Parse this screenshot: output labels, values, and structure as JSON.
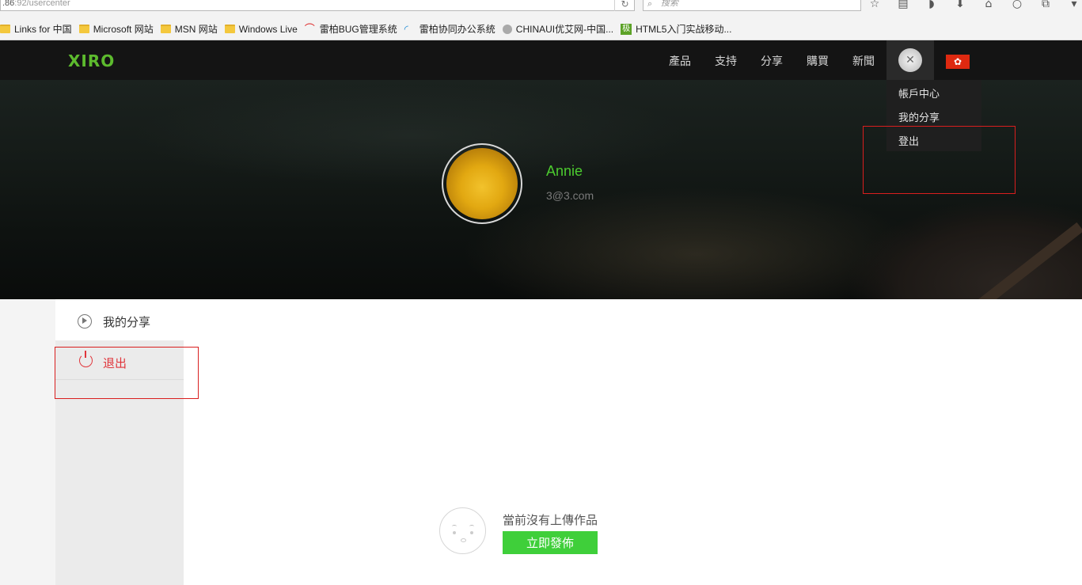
{
  "browser": {
    "url_host": ".86",
    "url_path": ":92/usercenter",
    "search_placeholder": "搜索",
    "reload_icon": "reload-icon",
    "toolbar_icons": [
      "star-icon",
      "reading-list-icon",
      "pocket-icon",
      "download-icon",
      "home-icon",
      "chat-icon",
      "extension-icon",
      "menu-icon"
    ]
  },
  "bookmarks": [
    {
      "label": "Links for 中国",
      "icon": "folder-icon"
    },
    {
      "label": "Microsoft 网站",
      "icon": "folder-icon"
    },
    {
      "label": "MSN 网站",
      "icon": "folder-icon"
    },
    {
      "label": "Windows Live",
      "icon": "folder-icon"
    },
    {
      "label": "雷柏BUG管理系统",
      "icon": "rapoo-icon"
    },
    {
      "label": "雷柏协同办公系统",
      "icon": "wifi-icon"
    },
    {
      "label": "CHINAUI优艾网-中国...",
      "icon": "globe-icon"
    },
    {
      "label": "HTML5入门实战移动...",
      "icon": "site-icon"
    }
  ],
  "nav": {
    "logo": "XIRO",
    "items": [
      "產品",
      "支持",
      "分享",
      "購買",
      "新聞"
    ],
    "flag_icon": "hong-kong-flag-icon"
  },
  "dropdown": {
    "items": [
      "帳戶中心",
      "我的分享",
      "登出"
    ]
  },
  "profile": {
    "name": "Annie",
    "email": "3@3.com"
  },
  "sidebar": {
    "items": [
      {
        "label": "我的分享",
        "icon": "play-circle-icon"
      },
      {
        "label": "退出",
        "icon": "power-icon"
      }
    ]
  },
  "empty_state": {
    "message": "當前沒有上傳作品",
    "button": "立即發佈"
  },
  "colors": {
    "brand_green": "#4ccb2f",
    "logout_red": "#e0353b",
    "annotation_red": "#d91e1e"
  }
}
